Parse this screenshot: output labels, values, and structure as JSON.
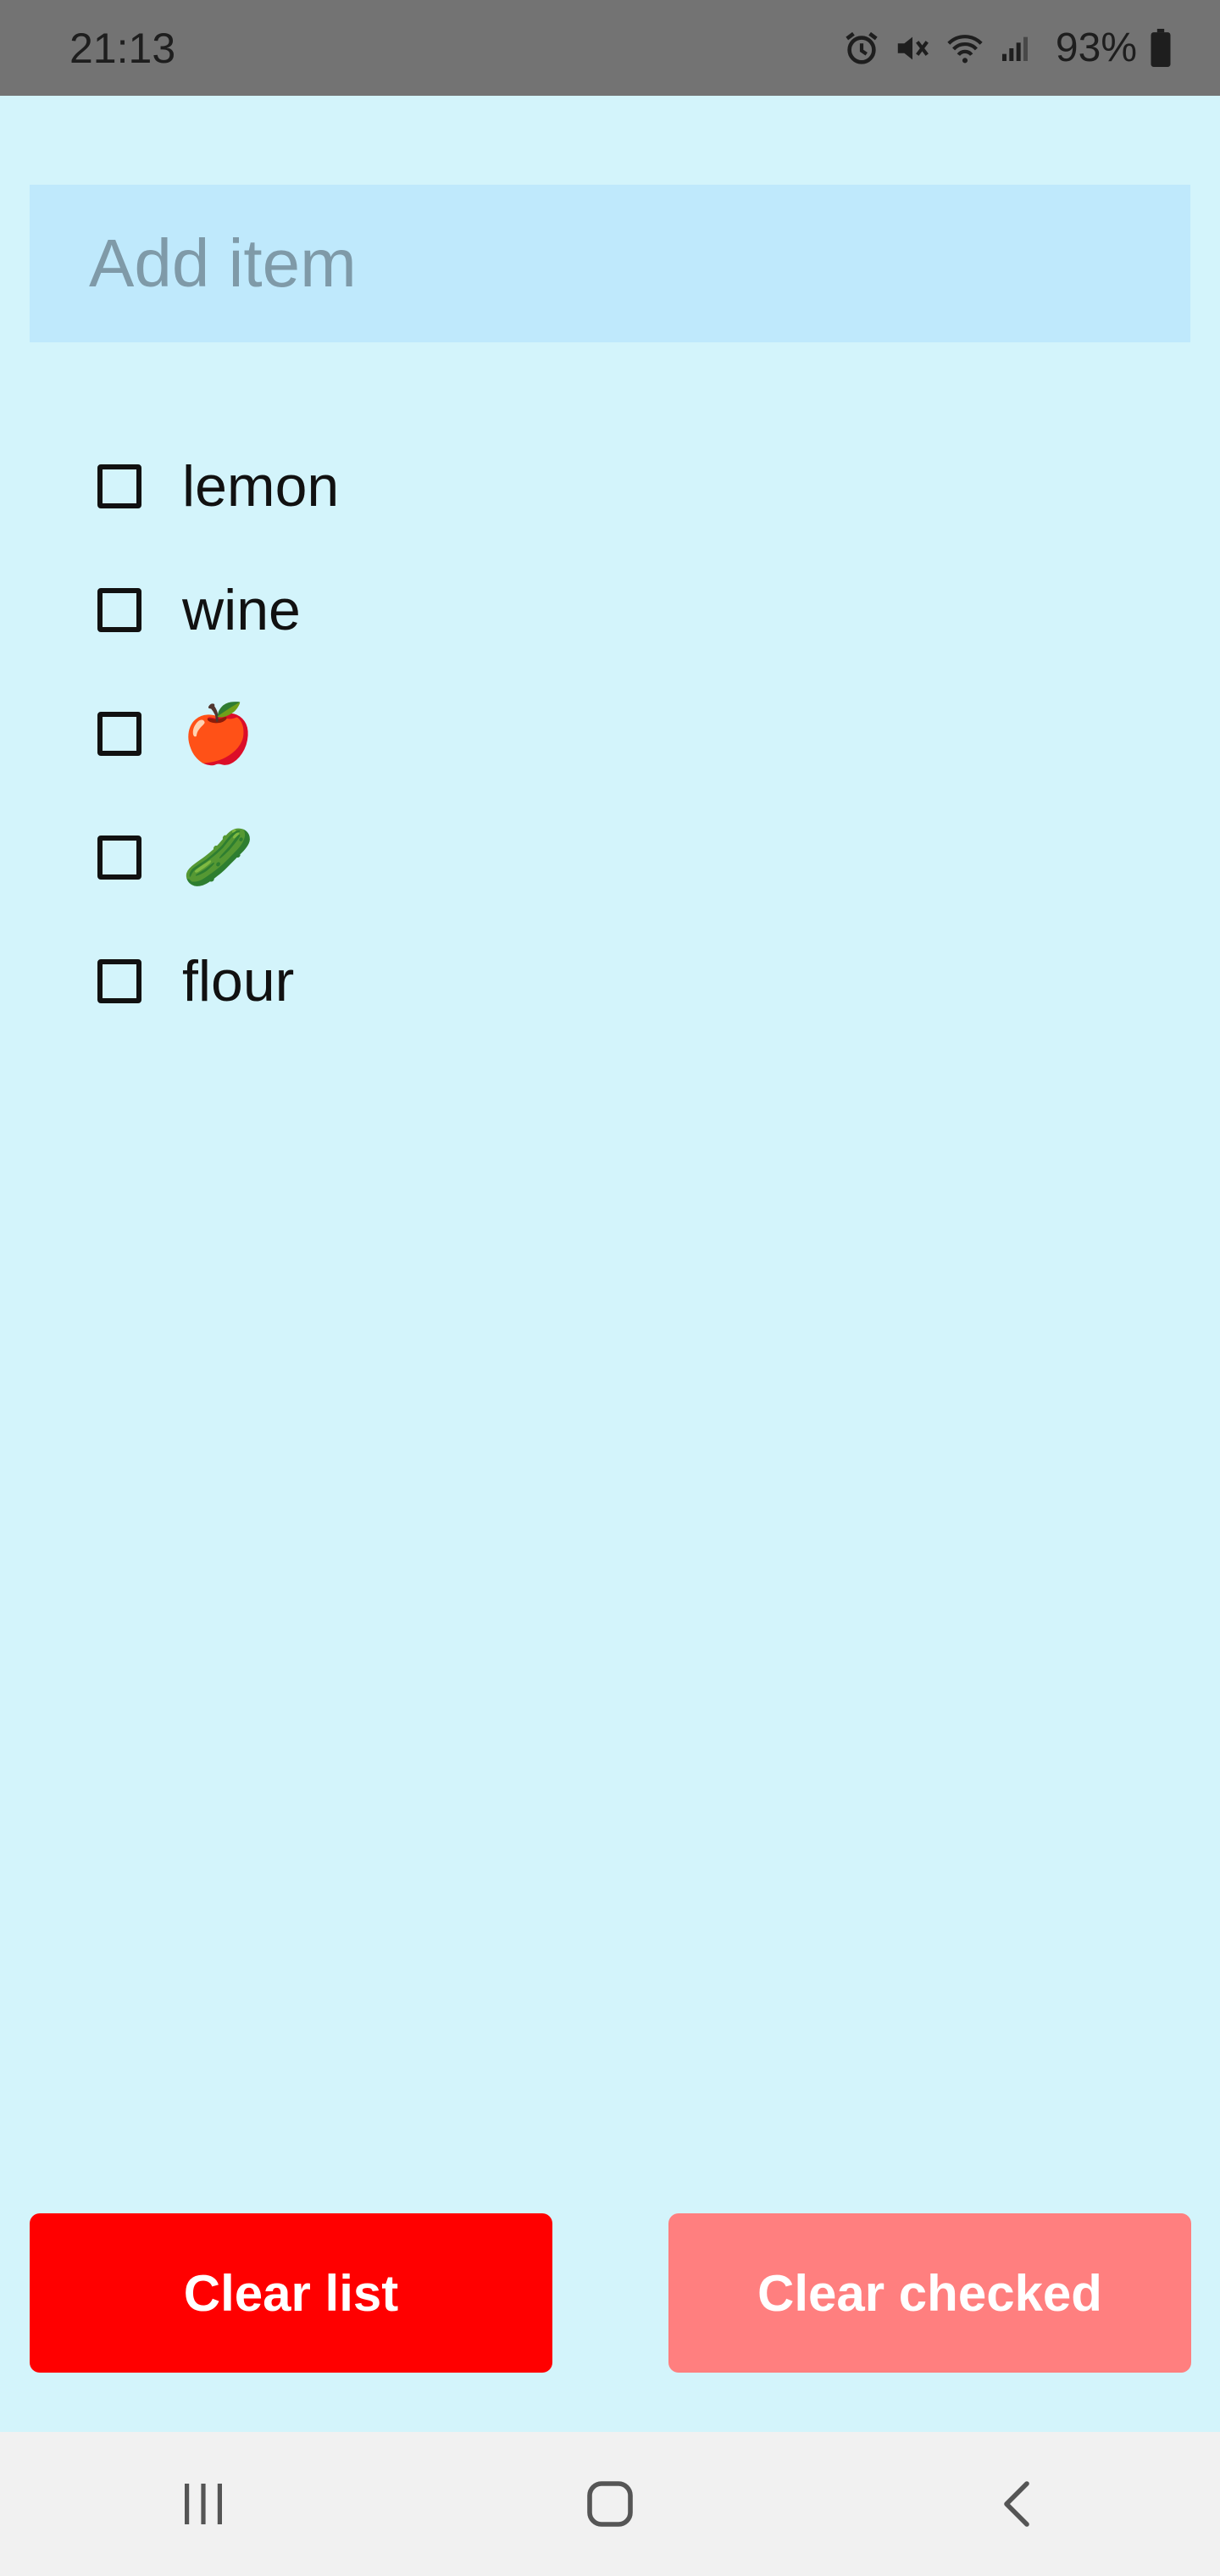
{
  "status_bar": {
    "time": "21:13",
    "battery": "93%",
    "icons": [
      "alarm-icon",
      "mute-icon",
      "wifi-icon",
      "signal-icon",
      "battery-icon"
    ]
  },
  "add_item": {
    "placeholder": "Add item",
    "value": ""
  },
  "items": [
    {
      "label": "lemon",
      "checked": false
    },
    {
      "label": "wine",
      "checked": false
    },
    {
      "label": "🍎",
      "checked": false
    },
    {
      "label": "🥒",
      "checked": false
    },
    {
      "label": "flour",
      "checked": false
    }
  ],
  "buttons": {
    "clear_list": "Clear list",
    "clear_checked": "Clear checked"
  },
  "nav_bar": {
    "icons": [
      "recent-apps-icon",
      "home-icon",
      "back-icon"
    ]
  },
  "colors": {
    "background": "#d3f4fb",
    "input_background": "#bfe9fc",
    "clear_list": "#ff0000",
    "clear_checked": "#ff7f7f"
  }
}
